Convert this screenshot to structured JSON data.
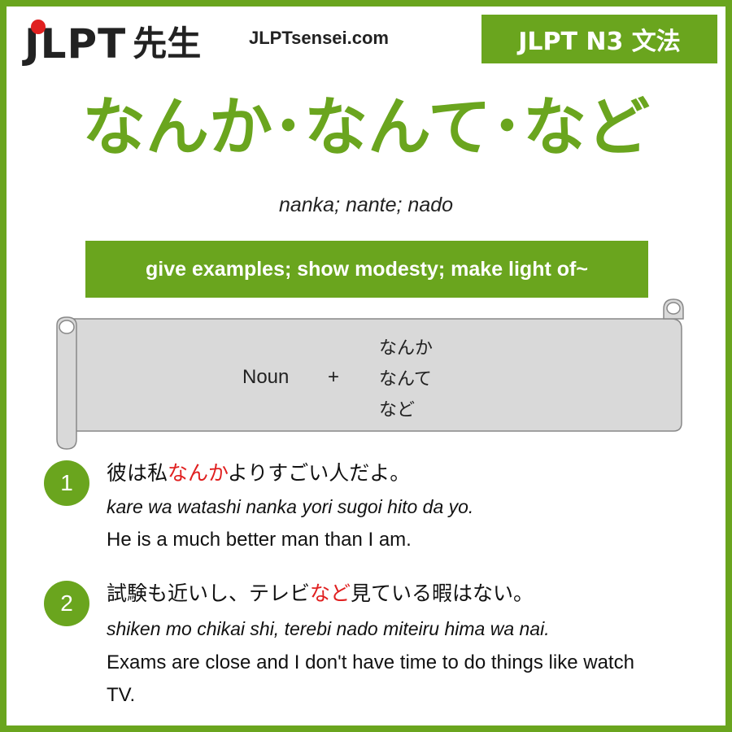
{
  "header": {
    "logo_latin": "JLPT",
    "logo_kanji": "先生",
    "site": "JLPTsensei.com",
    "level_badge": "JLPT N3 文法"
  },
  "grammar": {
    "title": "なんか･なんて･など",
    "romaji": "nanka; nante; nado",
    "meaning": "give examples; show modesty; make light of~"
  },
  "formula": {
    "noun": "Noun",
    "plus": "+",
    "forms": [
      "なんか",
      "なんて",
      "など"
    ]
  },
  "examples": [
    {
      "number": "1",
      "jp_before": "彼は私",
      "jp_highlight": "なんか",
      "jp_after": "よりすごい人だよ。",
      "romaji": "kare wa watashi nanka yori sugoi hito da yo.",
      "english": "He is a much better man than I am."
    },
    {
      "number": "2",
      "jp_before": "試験も近いし、テレビ",
      "jp_highlight": "など",
      "jp_after": "見ている暇はない。",
      "romaji": "shiken mo chikai shi, terebi nado miteiru hima wa nai.",
      "english": "Exams are close and I don't have time to do things like watch TV."
    }
  ],
  "colors": {
    "accent": "#6aa51e",
    "highlight": "#e02020",
    "scroll_fill": "#d9d9d9"
  }
}
